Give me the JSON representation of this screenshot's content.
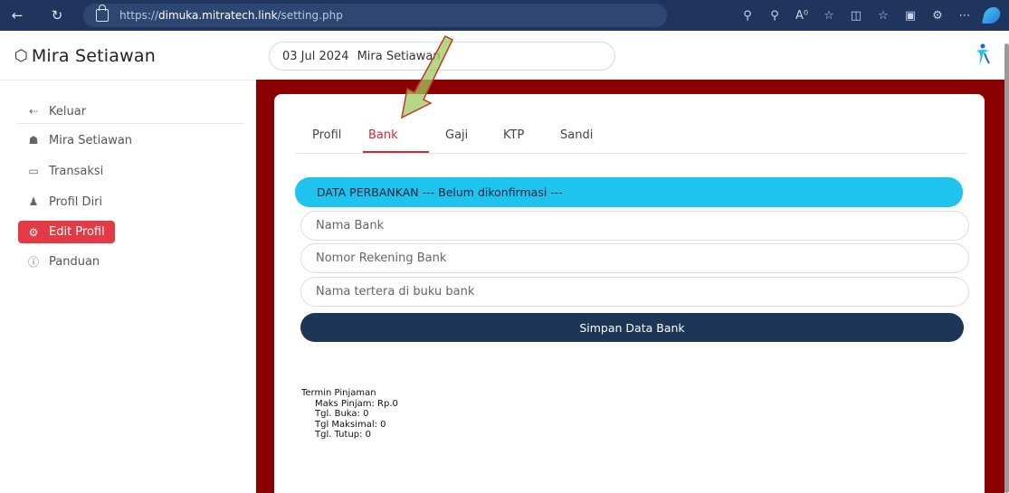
{
  "browser": {
    "url_prefix": "https://",
    "url_host": "dimuka.mitratech.link",
    "url_path": "/setting.php",
    "icons": [
      "back-icon",
      "refresh-icon",
      "lock-icon",
      "key-icon",
      "zoom-icon",
      "read-aloud-icon",
      "favorite-icon",
      "split-screen-icon",
      "favorites-list-icon",
      "collections-icon",
      "extensions-icon",
      "more-icon",
      "copilot-icon"
    ]
  },
  "header": {
    "brand_name": "Mira Setiawan",
    "brand_icon": "cube-icon",
    "date": "03 Jul 2024",
    "user_name": "Mira Setiawan"
  },
  "sidebar": {
    "items": [
      {
        "label": "Keluar",
        "icon": "logout-icon"
      },
      {
        "label": "Mira Setiawan",
        "icon": "home-icon"
      },
      {
        "label": "Transaksi",
        "icon": "window-icon"
      },
      {
        "label": "Profil Diri",
        "icon": "user-icon"
      },
      {
        "label": "Edit Profil",
        "icon": "gear-icon",
        "active": true
      },
      {
        "label": "Panduan",
        "icon": "help-icon"
      }
    ]
  },
  "tabs": [
    {
      "label": "Profil"
    },
    {
      "label": "Bank",
      "active": true
    },
    {
      "label": "Gaji"
    },
    {
      "label": "KTP"
    },
    {
      "label": "Sandi"
    }
  ],
  "bank_form": {
    "info_title": "DATA PERBANKAN --- Belum dikonfirmasi ---",
    "bank_name_placeholder": "Nama Bank",
    "account_number_placeholder": "Nomor Rekening Bank",
    "account_holder_placeholder": "Nama tertera di buku bank",
    "save_label": "Simpan Data Bank"
  },
  "loan_terms": {
    "title": "Termin Pinjaman",
    "max_loan": "Maks Pinjam: Rp.0",
    "open_date": "Tgl. Buka: 0",
    "max_date": "Tgl Maksimal: 0",
    "close_date": "Tgl. Tutup: 0"
  },
  "colors": {
    "browser_bar": "#20355e",
    "panel_background": "#8b0000",
    "accent_red": "#e23b45",
    "info_bar": "#1ec3ee",
    "save_button": "#1d3557",
    "annotation_arrow": "#9ccb5f"
  }
}
